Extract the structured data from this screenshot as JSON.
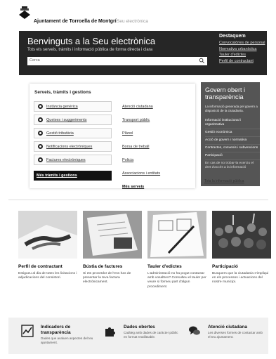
{
  "header": {
    "site_name": "Ajuntament de Torroella de Montgrí",
    "site_sub": "Seu electrònica"
  },
  "hero": {
    "title": "Benvinguts a la Seu electrònica",
    "subtitle": "Tots els serveis, tràmits i informació pública de forma directa i clara",
    "search_placeholder": "Cerca",
    "featured_title": "Destaquem",
    "featured_links": [
      "Convocatòries de personal",
      "Normativa urbanística",
      "Tauler d'edictes",
      "Perfil de contractant"
    ]
  },
  "services": {
    "title": "Serveis, tràmits i gestions",
    "left_items": [
      "Instància genèrica",
      "Queixes i suggeriments",
      "Gestió tributària",
      "Notificacions electròniques",
      "Factures electròniques"
    ],
    "left_more": "Més tràmits i gestions",
    "right_items": [
      "Atenció ciutadana",
      "Transport públic",
      "Plànol",
      "Borsa de treball",
      "Policia",
      "Associacions i entitats"
    ],
    "right_more": "Més serveis"
  },
  "govern": {
    "title": "Govern obert i transparència",
    "desc": "La informació generada pel govern a disposició de la ciutadania.",
    "links": [
      "Informació institucional i organitzativa",
      "Gestió econòmica",
      "Acció de govern i normativa",
      "Contractes, convenis i subvencions",
      "Participació"
    ],
    "note": "En cas de no trobar-la exerciu el dret d'accés a la informació",
    "all_link": "Tota la informació pública"
  },
  "cards": [
    {
      "title": "Perfil de contractant",
      "desc": "Estigueu al dia de totes les licitacions i adjudicacions del consistori."
    },
    {
      "title": "Bústia de factures",
      "desc": "Si ets proveïdor de l'ens has de presentar la teva factura electrònicament."
    },
    {
      "title": "Tauler d'edictes",
      "desc": "L'administració no ha pogut contactar amb vosaltres? Consulteu el tauler per veure si formeu part d'algun procediment."
    },
    {
      "title": "Participació",
      "desc": "Busquem que la ciutadania s'impliqui en els processos i actuacions del nostre municipi."
    }
  ],
  "footer": [
    {
      "title": "Indicadors de transparència",
      "desc": "Dades que avaluen aspectes del teu ajuntament.",
      "icon": "chart-line-icon"
    },
    {
      "title": "Dades obertes",
      "desc": "Catàleg amb dades de caràcter públic en format reutilitzable.",
      "icon": "puzzle-icon"
    },
    {
      "title": "Atenció ciutadana",
      "desc": "Les diverses formes de contactar amb el teu ajuntament.",
      "icon": "chat-bubbles-icon"
    }
  ]
}
